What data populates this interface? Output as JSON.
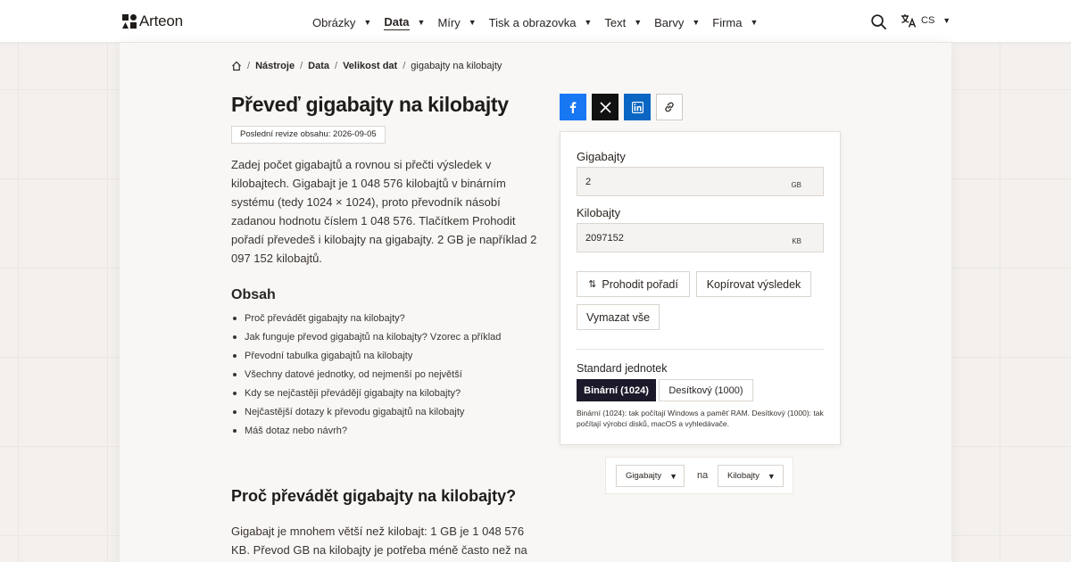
{
  "brand": {
    "name": "Arteon"
  },
  "nav": {
    "items": [
      {
        "label": "Obrázky",
        "active": false
      },
      {
        "label": "Data",
        "active": true
      },
      {
        "label": "Míry",
        "active": false
      },
      {
        "label": "Tisk a obrazovka",
        "active": false
      },
      {
        "label": "Text",
        "active": false
      },
      {
        "label": "Barvy",
        "active": false
      },
      {
        "label": "Firma",
        "active": false
      }
    ],
    "search_icon": "search-icon",
    "language": {
      "icon": "translate-icon",
      "code": "CS"
    }
  },
  "breadcrumb": {
    "home_icon": "home-icon",
    "items": [
      "Nástroje",
      "Data",
      "Velikost dat"
    ],
    "current": "gigabajty na kilobajty"
  },
  "page": {
    "title": "Převeď gigabajty na kilobajty",
    "revision": "Poslední revize obsahu: 2026-09-05",
    "intro": "Zadej počet gigabajtů a rovnou si přečti výsledek v kilobajtech. Gigabajt je 1 048 576 kilobajtů v binárním systému (tedy 1024 × 1024), proto převodník násobí zadanou hodnotu číslem 1 048 576. Tlačítkem Prohodit pořadí převedeš i kilobajty na gigabajty. 2 GB je například 2 097 152 kilobajtů."
  },
  "toc": {
    "title": "Obsah",
    "items": [
      "Proč převádět gigabajty na kilobajty?",
      "Jak funguje převod gigabajtů na kilobajty? Vzorec a příklad",
      "Převodní tabulka gigabajtů na kilobajty",
      "Všechny datové jednotky, od nejmenší po největší",
      "Kdy se nejčastěji převádějí gigabajty na kilobajty?",
      "Nejčastější dotazy k převodu gigabajtů na kilobajty",
      "Máš dotaz nebo návrh?"
    ]
  },
  "section": {
    "title": "Proč převádět gigabajty na kilobajty?",
    "text": "Gigabajt je mnohem větší než kilobajt: 1 GB je 1 048 576 KB. Převod GB na kilobajty je potřeba méně často než na"
  },
  "share": {
    "icons": [
      "facebook-icon",
      "x-icon",
      "linkedin-icon",
      "link-icon"
    ],
    "colors": {
      "facebook": "#1877f2",
      "x": "#111111",
      "linkedin": "#0a66c2"
    }
  },
  "converter": {
    "from": {
      "label": "Gigabajty",
      "value": "2",
      "unit": "GB"
    },
    "to": {
      "label": "Kilobajty",
      "value": "2097152",
      "unit": "KB"
    },
    "swap_label": "Prohodit pořadí",
    "copy_label": "Kopírovat výsledek",
    "clear_label": "Vymazat vše",
    "standard": {
      "label": "Standard jednotek",
      "options": [
        "Binární (1024)",
        "Desítkový (1000)"
      ],
      "selected": "Binární (1024)",
      "note": "Binární (1024): tak počítají Windows a paměť RAM. Desítkový (1000): tak počítají výrobci disků, macOS a vyhledávače."
    },
    "accent_color": "#1c1a2a"
  },
  "unit_select": {
    "from": "Gigabajty",
    "joiner": "na",
    "to": "Kilobajty"
  }
}
